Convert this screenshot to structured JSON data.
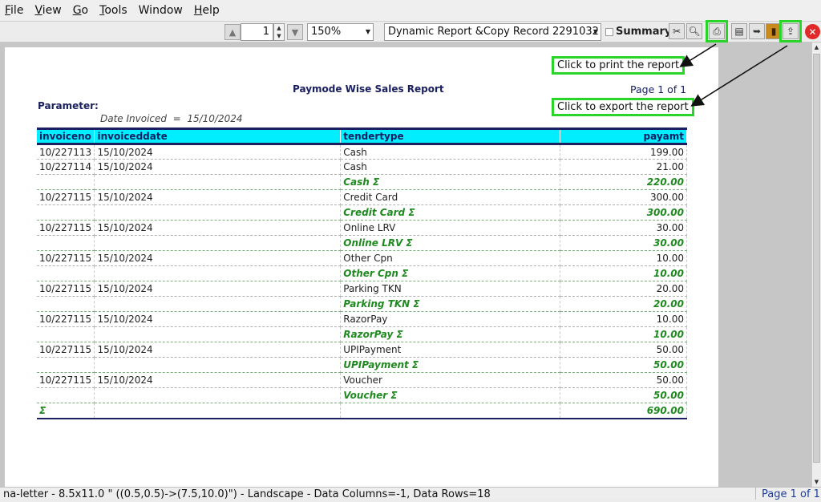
{
  "menu": [
    {
      "u": "F",
      "rest": "ile"
    },
    {
      "u": "V",
      "rest": "iew"
    },
    {
      "u": "G",
      "rest": "o"
    },
    {
      "u": "T",
      "rest": "ools"
    },
    {
      "u": "",
      "rest": "Window"
    },
    {
      "u": "H",
      "rest": "elp"
    }
  ],
  "toolbar": {
    "page_number": "1",
    "zoom": "150%",
    "report_select": "Dynamic Report &Copy Record 2291032",
    "summary_label": "Summary",
    "icons": [
      "up-arrow-icon",
      "down-arrow-icon",
      "settings-icon",
      "zoom-icon",
      "print-icon",
      "printer-setup-icon",
      "export-icon",
      "book-icon",
      "export-file-icon",
      "close-icon"
    ]
  },
  "report": {
    "title": "Paymode Wise Sales Report",
    "page": "Page 1 of 1",
    "parameter_label": "Parameter:",
    "parameter_line": "Date Invoiced  =  15/10/2024",
    "columns": [
      "invoiceno",
      "invoiceddate",
      "tendertype",
      "payamt"
    ],
    "rows": [
      {
        "type": "data",
        "cells": [
          "10/227113",
          "15/10/2024",
          "Cash",
          "199.00"
        ]
      },
      {
        "type": "data",
        "cells": [
          "10/227114",
          "15/10/2024",
          "Cash",
          "21.00"
        ]
      },
      {
        "type": "sub",
        "cells": [
          "",
          "",
          "Cash Σ",
          "220.00"
        ]
      },
      {
        "type": "data",
        "cells": [
          "10/227115",
          "15/10/2024",
          "Credit Card",
          "300.00"
        ]
      },
      {
        "type": "sub",
        "cells": [
          "",
          "",
          "Credit Card Σ",
          "300.00"
        ]
      },
      {
        "type": "data",
        "cells": [
          "10/227115",
          "15/10/2024",
          "Online LRV",
          "30.00"
        ]
      },
      {
        "type": "sub",
        "cells": [
          "",
          "",
          "Online LRV Σ",
          "30.00"
        ]
      },
      {
        "type": "data",
        "cells": [
          "10/227115",
          "15/10/2024",
          "Other Cpn",
          "10.00"
        ]
      },
      {
        "type": "sub",
        "cells": [
          "",
          "",
          "Other Cpn Σ",
          "10.00"
        ]
      },
      {
        "type": "data",
        "cells": [
          "10/227115",
          "15/10/2024",
          "Parking TKN",
          "20.00"
        ]
      },
      {
        "type": "sub",
        "cells": [
          "",
          "",
          "Parking TKN Σ",
          "20.00"
        ]
      },
      {
        "type": "data",
        "cells": [
          "10/227115",
          "15/10/2024",
          "RazorPay",
          "10.00"
        ]
      },
      {
        "type": "sub",
        "cells": [
          "",
          "",
          "RazorPay Σ",
          "10.00"
        ]
      },
      {
        "type": "data",
        "cells": [
          "10/227115",
          "15/10/2024",
          "UPIPayment",
          "50.00"
        ]
      },
      {
        "type": "sub",
        "cells": [
          "",
          "",
          "UPIPayment Σ",
          "50.00"
        ]
      },
      {
        "type": "data",
        "cells": [
          "10/227115",
          "15/10/2024",
          "Voucher",
          "50.00"
        ]
      },
      {
        "type": "sub",
        "cells": [
          "",
          "",
          "Voucher Σ",
          "50.00"
        ]
      },
      {
        "type": "tot",
        "cells": [
          "Σ",
          "",
          "",
          "690.00"
        ]
      }
    ]
  },
  "callouts": {
    "print": "Click to print the report",
    "export": "Click to export the report"
  },
  "status": {
    "text": "na-letter - 8.5x11.0 \" ((0.5,0.5)->(7.5,10.0)\") - Landscape - Data Columns=-1, Data Rows=18",
    "page": "Page 1 of 1"
  },
  "colors": {
    "header_bg": "#00eeff",
    "subtotal_text": "#1f8a1f",
    "highlight": "#2ad52a"
  }
}
